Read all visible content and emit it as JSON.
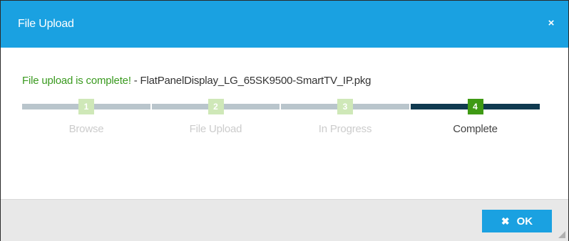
{
  "dialog": {
    "title": "File Upload",
    "close_icon": "×"
  },
  "message": {
    "status": "File upload is complete!",
    "separator": " - ",
    "filename": "FlatPanelDisplay_LG_65SK9500-SmartTV_IP.pkg"
  },
  "steps": [
    {
      "number": "1",
      "label": "Browse",
      "active": false
    },
    {
      "number": "2",
      "label": "File Upload",
      "active": false
    },
    {
      "number": "3",
      "label": "In Progress",
      "active": false
    },
    {
      "number": "4",
      "label": "Complete",
      "active": true
    }
  ],
  "footer": {
    "ok_icon": "✖",
    "ok_label": "OK"
  },
  "colors": {
    "accent": "#1aa1e1",
    "success": "#3a9a1f",
    "step_active_bar": "#103a50",
    "step_inactive_bar": "#b9c5cc"
  }
}
